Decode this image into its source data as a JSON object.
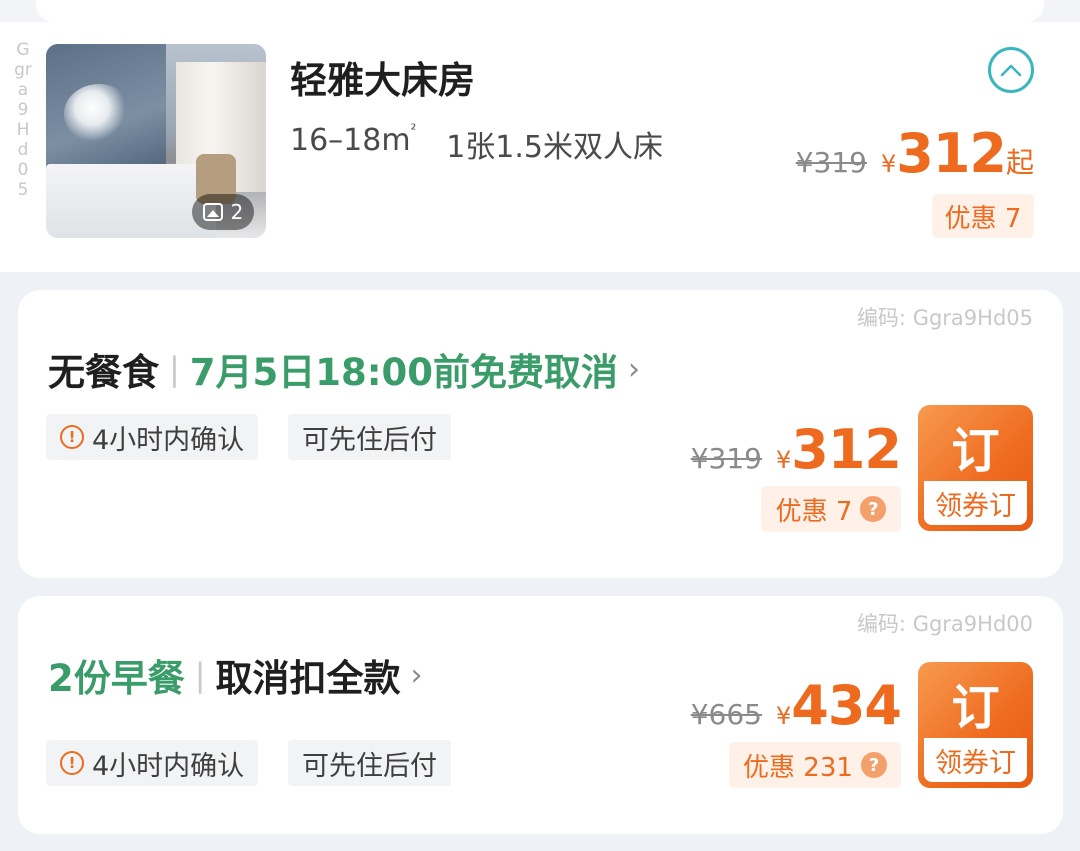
{
  "vertical_code": "Ggra9Hd05",
  "room": {
    "name": "轻雅大床房",
    "area": "16–18m",
    "area_unit_sup": "²",
    "bed": "1张1.5米双人床",
    "photo_count": "2",
    "original_price": "¥319",
    "currency": "¥",
    "price": "312",
    "price_suffix": "起",
    "discount": "优惠 7"
  },
  "plans": [
    {
      "code": "编码: Ggra9Hd05",
      "meal": "无餐食",
      "policy": "7月5日18:00前免费取消",
      "tags": [
        "4小时内确认",
        "可先住后付"
      ],
      "original_price": "¥319",
      "currency": "¥",
      "price": "312",
      "discount": "优惠 7",
      "book_main": "订",
      "book_sub": "领券订"
    },
    {
      "code": "编码: Ggra9Hd00",
      "meal": "2份早餐",
      "policy": "取消扣全款",
      "tags": [
        "4小时内确认",
        "可先住后付"
      ],
      "original_price": "¥665",
      "currency": "¥",
      "price": "434",
      "discount": "优惠 231",
      "book_main": "订",
      "book_sub": "领券订"
    }
  ],
  "colors": {
    "accent_orange": "#ee6a1e",
    "green": "#3a9c69",
    "teal": "#3ab7be"
  }
}
